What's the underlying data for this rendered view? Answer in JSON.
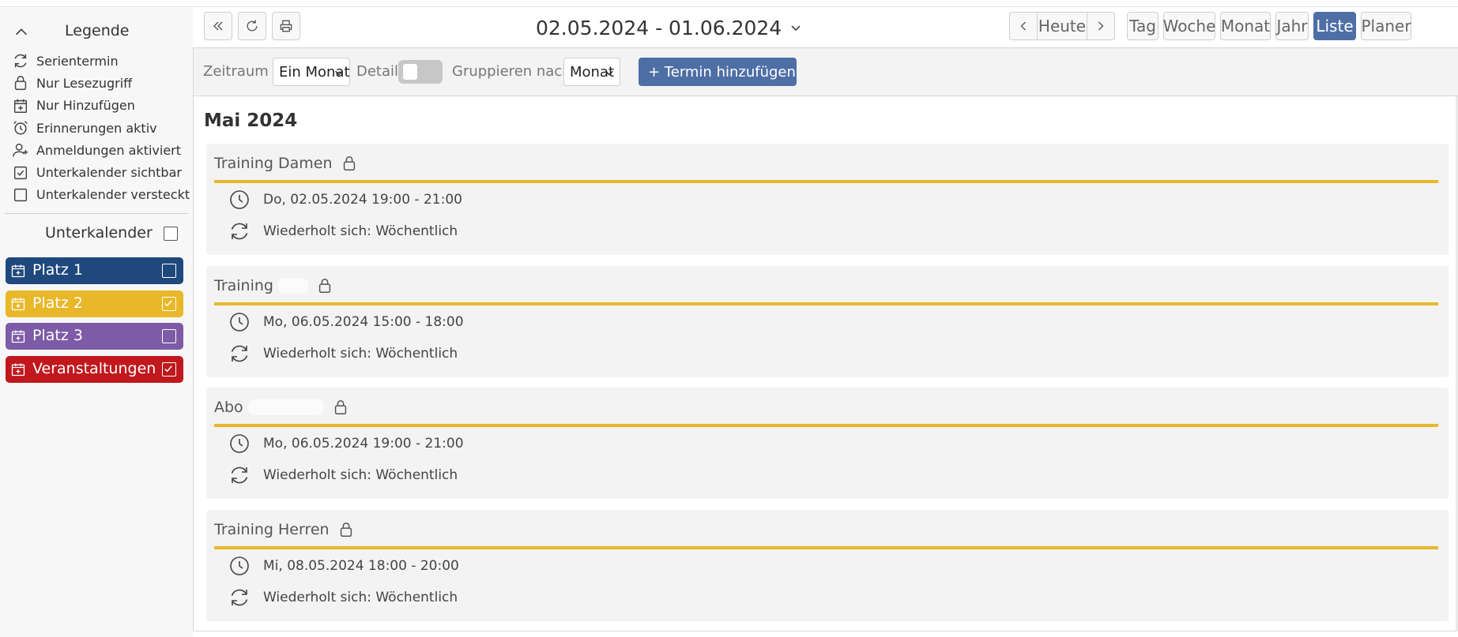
{
  "sidebar": {
    "legend_title": "Legende",
    "legend_items": [
      {
        "icon": "repeat-icon",
        "label": "Serientermin"
      },
      {
        "icon": "lock-icon",
        "label": "Nur Lesezugriff"
      },
      {
        "icon": "calendar-plus-icon",
        "label": "Nur Hinzufügen"
      },
      {
        "icon": "alarm-clock-icon",
        "label": "Erinnerungen aktiv"
      },
      {
        "icon": "user-plus-icon",
        "label": "Anmeldungen aktiviert"
      },
      {
        "icon": "checkbox-checked-icon",
        "label": "Unterkalender sichtbar"
      },
      {
        "icon": "checkbox-empty-icon",
        "label": "Unterkalender versteckt"
      }
    ],
    "subcalendar_title": "Unterkalender",
    "calendars": [
      {
        "label": "Platz 1",
        "color": "#1f497d",
        "checked": false
      },
      {
        "label": "Platz 2",
        "color": "#e8b82a",
        "checked": true
      },
      {
        "label": "Platz 3",
        "color": "#7d5ba6",
        "checked": false
      },
      {
        "label": "Veranstaltungen",
        "color": "#c0181d",
        "checked": true
      }
    ]
  },
  "header": {
    "date_range": "02.05.2024 - 01.06.2024",
    "today_label": "Heute",
    "views": [
      "Tag",
      "Woche",
      "Monat",
      "Jahr",
      "Liste",
      "Planer"
    ],
    "active_view": "Liste"
  },
  "toolbar": {
    "period_label": "Zeitraum",
    "period_value": "Ein Monat",
    "details_label": "Details",
    "details_on": false,
    "group_label": "Gruppieren nach",
    "group_value": "Monat",
    "add_label": "+ Termin hinzufügen"
  },
  "main": {
    "month_title": "Mai 2024",
    "events": [
      {
        "title": "Training Damen",
        "when": "Do, 02.05.2024 19:00 - 21:00",
        "repeat": "Wiederholt sich: Wöchentlich"
      },
      {
        "title": "Training",
        "when": "Mo, 06.05.2024 15:00 - 18:00",
        "repeat": "Wiederholt sich: Wöchentlich"
      },
      {
        "title": "Abo",
        "when": "Mo, 06.05.2024 19:00 - 21:00",
        "repeat": "Wiederholt sich: Wöchentlich"
      },
      {
        "title": "Training Herren",
        "when": "Mi, 08.05.2024 18:00 - 20:00",
        "repeat": "Wiederholt sich: Wöchentlich"
      }
    ]
  },
  "colors": {
    "accent": "#4e6fa6",
    "event_bar": "#e8b82a"
  }
}
